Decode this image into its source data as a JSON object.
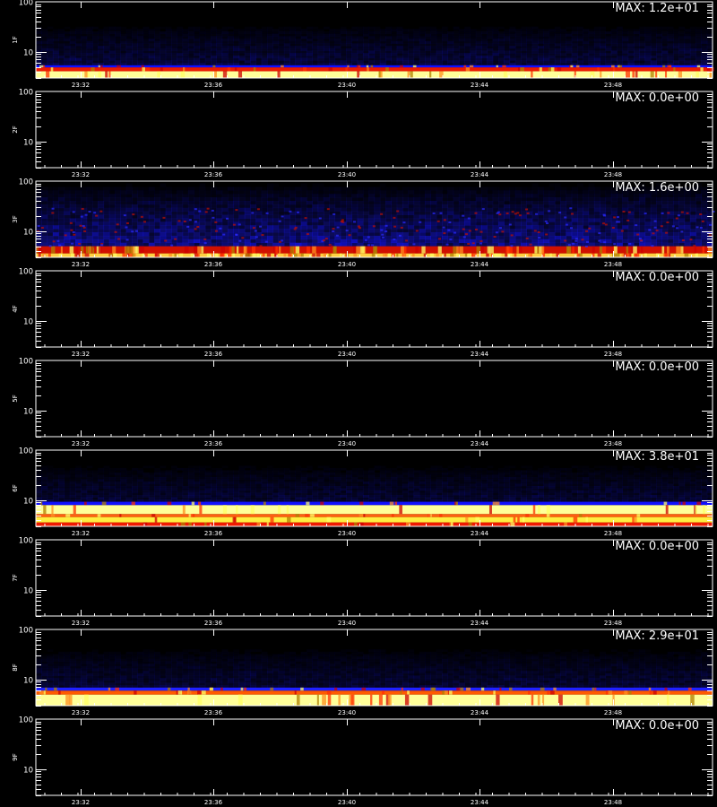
{
  "chart_data": [
    {
      "type": "heatmap",
      "ylabel": "1F",
      "max_label": "MAX: 1.2e+01",
      "max_value": 12.0,
      "ylim": [
        3,
        100
      ],
      "yscale": "log",
      "y_ticks": [
        "100",
        "10"
      ],
      "x_ticks": [
        "23:32",
        "23:36",
        "23:40",
        "23:44",
        "23:48"
      ],
      "xlim": [
        "23:30:30",
        "23:51:00"
      ],
      "activity": "bright band below 5, red band ~5, faint blue spread up to ~15"
    },
    {
      "type": "heatmap",
      "ylabel": "2F",
      "max_label": "MAX: 0.0e+00",
      "max_value": 0.0,
      "ylim": [
        3,
        100
      ],
      "yscale": "log",
      "y_ticks": [
        "100",
        "10"
      ],
      "x_ticks": [
        "23:32",
        "23:36",
        "23:40",
        "23:44",
        "23:48"
      ],
      "xlim": [
        "23:30:30",
        "23:51:00"
      ],
      "activity": "none"
    },
    {
      "type": "heatmap",
      "ylabel": "3F",
      "max_label": "MAX: 1.6e+00",
      "max_value": 1.6,
      "ylim": [
        3,
        100
      ],
      "yscale": "log",
      "y_ticks": [
        "100",
        "10"
      ],
      "x_ticks": [
        "23:32",
        "23:36",
        "23:40",
        "23:44",
        "23:48"
      ],
      "xlim": [
        "23:30:30",
        "23:51:00"
      ],
      "activity": "noisy blue/red spread up to ~30, bright speckle near bottom"
    },
    {
      "type": "heatmap",
      "ylabel": "4F",
      "max_label": "MAX: 0.0e+00",
      "max_value": 0.0,
      "ylim": [
        3,
        100
      ],
      "yscale": "log",
      "y_ticks": [
        "100",
        "10"
      ],
      "x_ticks": [
        "23:32",
        "23:36",
        "23:40",
        "23:44",
        "23:48"
      ],
      "xlim": [
        "23:30:30",
        "23:51:00"
      ],
      "activity": "none"
    },
    {
      "type": "heatmap",
      "ylabel": "5F",
      "max_label": "MAX: 0.0e+00",
      "max_value": 0.0,
      "ylim": [
        3,
        100
      ],
      "yscale": "log",
      "y_ticks": [
        "100",
        "10"
      ],
      "x_ticks": [
        "23:32",
        "23:36",
        "23:40",
        "23:44",
        "23:48"
      ],
      "xlim": [
        "23:30:30",
        "23:51:00"
      ],
      "activity": "none"
    },
    {
      "type": "heatmap",
      "ylabel": "6F",
      "max_label": "MAX: 3.8e+01",
      "max_value": 38.0,
      "ylim": [
        3,
        100
      ],
      "yscale": "log",
      "y_ticks": [
        "100",
        "10"
      ],
      "x_ticks": [
        "23:32",
        "23:36",
        "23:40",
        "23:44",
        "23:48"
      ],
      "xlim": [
        "23:30:30",
        "23:51:00"
      ],
      "activity": "bright yellow/red bands up to ~9, faint blue above"
    },
    {
      "type": "heatmap",
      "ylabel": "7F",
      "max_label": "MAX: 0.0e+00",
      "max_value": 0.0,
      "ylim": [
        3,
        100
      ],
      "yscale": "log",
      "y_ticks": [
        "100",
        "10"
      ],
      "x_ticks": [
        "23:32",
        "23:36",
        "23:40",
        "23:44",
        "23:48"
      ],
      "xlim": [
        "23:30:30",
        "23:51:00"
      ],
      "activity": "none"
    },
    {
      "type": "heatmap",
      "ylabel": "8F",
      "max_label": "MAX: 2.9e+01",
      "max_value": 29.0,
      "ylim": [
        3,
        100
      ],
      "yscale": "log",
      "y_ticks": [
        "100",
        "10"
      ],
      "x_ticks": [
        "23:32",
        "23:36",
        "23:40",
        "23:44",
        "23:48"
      ],
      "xlim": [
        "23:30:30",
        "23:51:00"
      ],
      "activity": "bright band below ~5.5, red/blue edge ~6-7, faint blue above"
    },
    {
      "type": "heatmap",
      "ylabel": "9F",
      "max_label": "MAX: 0.0e+00",
      "max_value": 0.0,
      "ylim": [
        3,
        100
      ],
      "yscale": "log",
      "y_ticks": [
        "100",
        "10"
      ],
      "x_ticks": [
        "23:32",
        "23:36",
        "23:40",
        "23:44",
        "23:48"
      ],
      "xlim": [
        "23:30:30",
        "23:51:00"
      ],
      "activity": "none"
    }
  ],
  "colors": {
    "background": "#000000",
    "axis": "#ffffff",
    "low": "#0000ff",
    "mid": "#ff2000",
    "high": "#ffff80"
  }
}
